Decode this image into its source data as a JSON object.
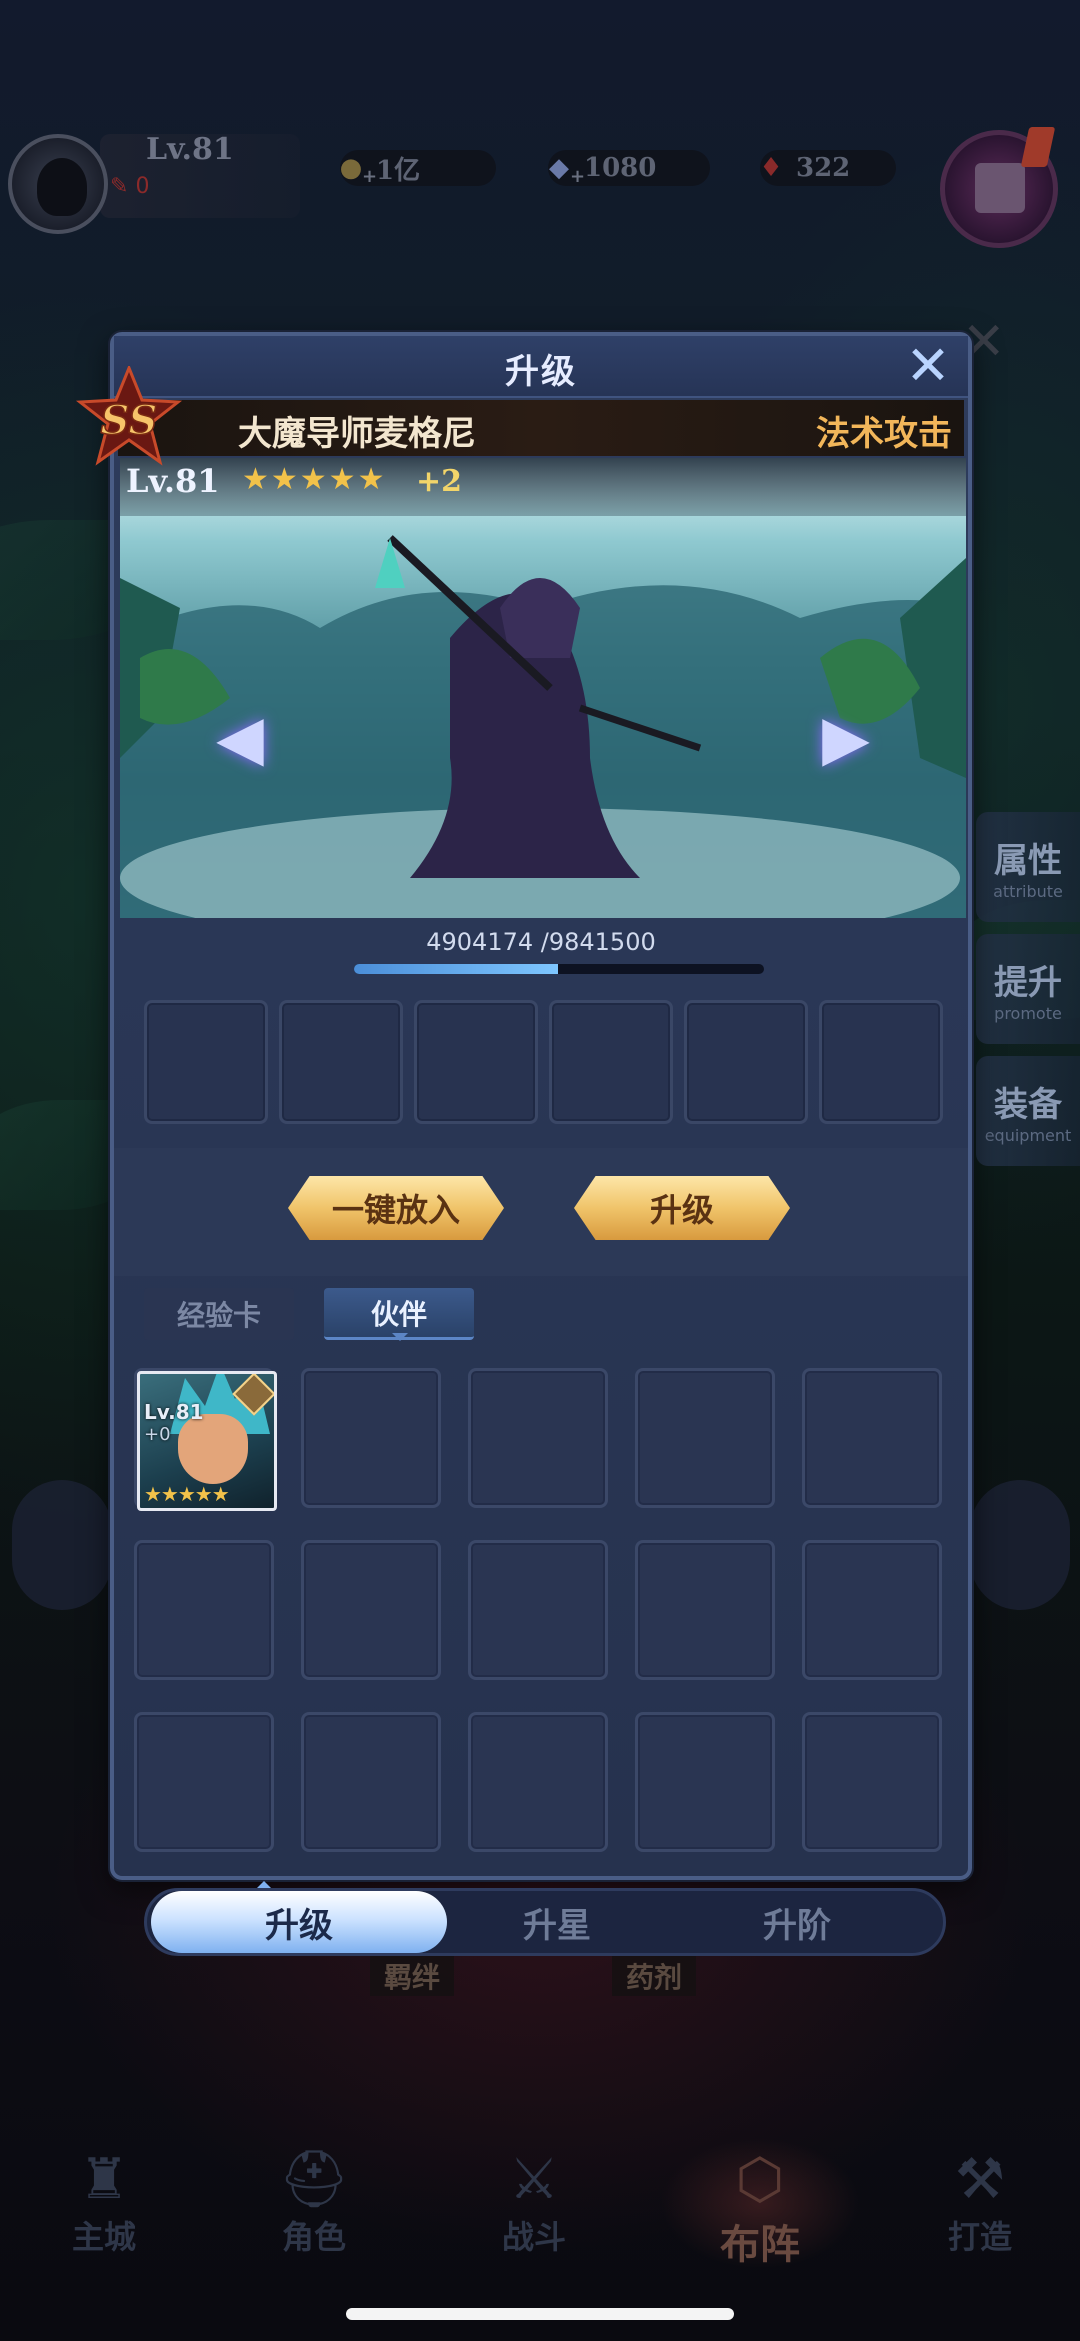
{
  "hud": {
    "level": "Lv.81",
    "red_value": "0",
    "resources": [
      {
        "icon": "gold-bag-icon",
        "value": "1亿"
      },
      {
        "icon": "diamond-icon",
        "value": "1080"
      },
      {
        "icon": "ruby-icon",
        "value": "322"
      }
    ]
  },
  "side_tabs": [
    {
      "label": "属性",
      "sub": "attribute"
    },
    {
      "label": "提升",
      "sub": "promote"
    },
    {
      "label": "装备",
      "sub": "equipment"
    }
  ],
  "panel": {
    "title": "升级",
    "rank": "SS",
    "hero_name": "大魔导师麦格尼",
    "hero_type": "法术攻击",
    "hero_level": "Lv.81",
    "stars": "★★★★★",
    "plus_level": "+2",
    "exp_text": "4904174 /9841500",
    "exp_progress": 0.498
  },
  "buttons": {
    "auto_fill": "一键放入",
    "upgrade": "升级"
  },
  "sub_tabs": {
    "exp_card": "经验卡",
    "partner": "伙伴"
  },
  "partner_card": {
    "level": "Lv.81",
    "plus": "+0",
    "stars": "★★★★★"
  },
  "bottom_tabs": [
    "升级",
    "升星",
    "升阶"
  ],
  "under_labels": [
    "羁绊",
    "药剂"
  ],
  "nav": [
    {
      "label": "主城",
      "icon": "castle-icon"
    },
    {
      "label": "角色",
      "icon": "helmet-icon"
    },
    {
      "label": "战斗",
      "icon": "crossed-swords-icon"
    },
    {
      "label": "布阵",
      "icon": "formation-icon"
    },
    {
      "label": "打造",
      "icon": "anvil-icon"
    }
  ],
  "colors": {
    "accent_gold": "#f2b65a",
    "panel_bg": "#2a3756",
    "star": "#f2c24a"
  }
}
